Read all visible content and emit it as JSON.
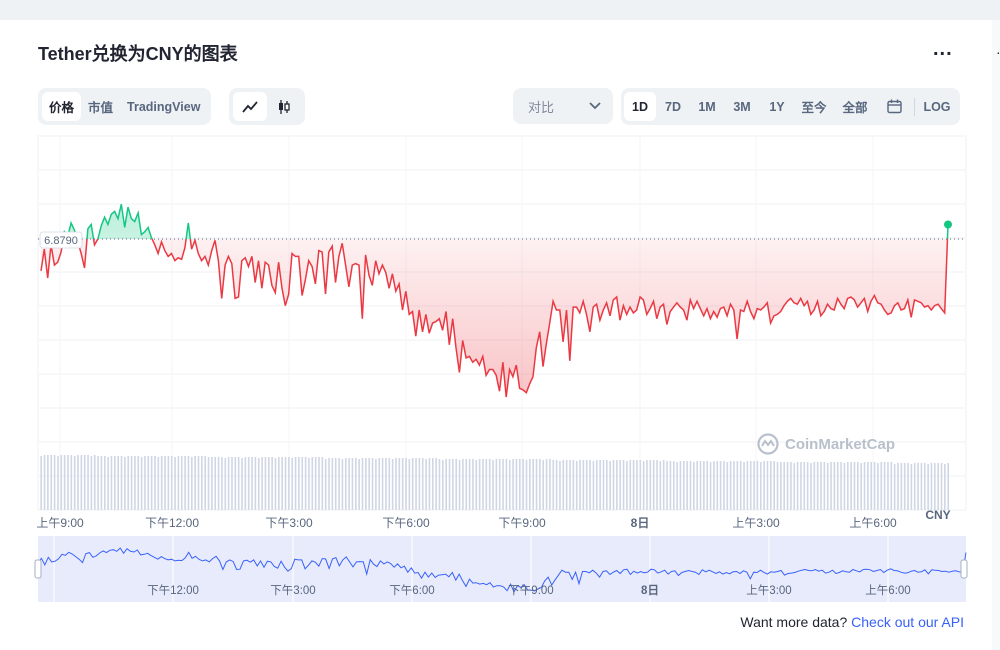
{
  "title": "Tether兑换为CNY的图表",
  "more_label": "...",
  "view_tabs": [
    "价格",
    "市值",
    "TradingView"
  ],
  "compare": {
    "label": "对比"
  },
  "range_tabs": [
    "1D",
    "7D",
    "1M",
    "3M",
    "1Y",
    "至今",
    "全部"
  ],
  "log_label": "LOG",
  "watermark": "CoinMarketCap",
  "api": {
    "prefix": "Want more data?",
    "link": "Check out our API"
  },
  "colors": {
    "up": "#16c784",
    "down": "#ea3943",
    "accent": "#3861fb",
    "volume": "#cfd6e4",
    "nav_fill": "#e5e9fc"
  },
  "chart_data": {
    "type": "line",
    "reference_value": 6.879,
    "reference_label": "6.8790",
    "currency_label": "CNY",
    "x_ticks": [
      "上午9:00",
      "下午12:00",
      "下午3:00",
      "下午6:00",
      "下午9:00",
      "8日",
      "上午3:00",
      "上午6:00"
    ],
    "nav_ticks": [
      "下午12:00",
      "下午3:00",
      "下午6:00",
      "下午9:00",
      "8日",
      "上午3:00",
      "上午6:00"
    ],
    "price_series": [
      6.8768,
      6.8783,
      6.8763,
      6.8786,
      6.8772,
      6.8774,
      6.8781,
      6.8795,
      6.8792,
      6.8801,
      6.8796,
      6.8788,
      6.878,
      6.877,
      6.8797,
      6.88,
      6.8786,
      6.879,
      6.8799,
      6.8805,
      6.88,
      6.8807,
      6.8809,
      6.8804,
      6.8814,
      6.8798,
      6.8812,
      6.8804,
      6.8802,
      6.8808,
      6.8793,
      6.8795,
      6.8798,
      6.8791,
      6.8786,
      6.878,
      6.8788,
      6.8782,
      6.8778,
      6.878,
      6.8775,
      6.8777,
      6.8776,
      6.8784,
      6.8801,
      6.8783,
      6.8789,
      6.878,
      6.8775,
      6.8778,
      6.8772,
      6.8782,
      6.8789,
      6.8775,
      6.8749,
      6.8772,
      6.8778,
      6.8773,
      6.8749,
      6.875,
      6.8775,
      6.8777,
      6.8771,
      6.8778,
      6.876,
      6.8775,
      6.8756,
      6.8774,
      6.8772,
      6.8758,
      6.8753,
      6.8774,
      6.8756,
      6.8744,
      6.8752,
      6.878,
      6.8778,
      6.8778,
      6.8751,
      6.8762,
      6.8775,
      6.8771,
      6.8759,
      6.8782,
      6.8781,
      6.8752,
      6.8781,
      6.8785,
      6.876,
      6.8778,
      6.8787,
      6.8772,
      6.8757,
      6.8772,
      6.8773,
      6.8772,
      6.8735,
      6.8779,
      6.8765,
      6.8758,
      6.8775,
      6.8766,
      6.8772,
      6.8767,
      6.8756,
      6.8766,
      6.8754,
      6.8759,
      6.8741,
      6.8754,
      6.8738,
      6.874,
      6.8723,
      6.8741,
      6.8726,
      6.8738,
      6.8725,
      6.8732,
      6.8733,
      6.8735,
      6.8727,
      6.874,
      6.8717,
      6.8735,
      6.8715,
      6.8698,
      6.872,
      6.8708,
      6.8709,
      6.8705,
      6.8707,
      6.8703,
      6.8709,
      6.8696,
      6.87,
      6.87,
      6.8696,
      6.8685,
      6.8705,
      6.8681,
      6.87,
      6.8695,
      6.8703,
      6.8687,
      6.8686,
      6.8684,
      6.869,
      6.8695,
      6.8715,
      6.8726,
      6.8702,
      6.8718,
      6.8732,
      6.8747,
      6.8741,
      6.8741,
      6.8719,
      6.8741,
      6.8706,
      6.8743,
      6.8743,
      6.8739,
      6.8747,
      6.8738,
      6.8726,
      6.8743,
      6.8745,
      6.8734,
      6.8741,
      6.8746,
      6.8737,
      6.8748,
      6.875,
      6.8734,
      6.8744,
      6.8738,
      6.8743,
      6.8739,
      6.8741,
      6.875,
      6.8748,
      6.8738,
      6.8742,
      6.8747,
      6.8735,
      6.8743,
      6.8745,
      6.8731,
      6.874,
      6.8743,
      6.8746,
      6.8743,
      6.8741,
      6.8734,
      6.8748,
      6.8742,
      6.8747,
      6.8742,
      6.8737,
      6.8742,
      6.8735,
      6.874,
      6.8736,
      6.8742,
      6.8743,
      6.8737,
      6.8745,
      6.8741,
      6.8721,
      6.8741,
      6.874,
      6.8747,
      6.874,
      6.8735,
      6.8742,
      6.8741,
      6.8743,
      6.8746,
      6.8732,
      6.8737,
      6.8738,
      6.874,
      6.8744,
      6.8747,
      6.8749,
      6.8746,
      6.8745,
      6.8749,
      6.8744,
      6.8747,
      6.8738,
      6.8741,
      6.8747,
      6.8737,
      6.874,
      6.8745,
      6.8742,
      6.8741,
      6.8749,
      6.8745,
      6.8742,
      6.8749,
      6.875,
      6.8748,
      6.8743,
      6.8746,
      6.8749,
      6.874,
      6.8747,
      6.8751,
      6.8746,
      6.8745,
      6.8741,
      6.8738,
      6.8739,
      6.8744,
      6.8746,
      6.8741,
      6.8742,
      6.8748,
      6.8736,
      6.8748,
      6.8747,
      6.8746,
      6.8743,
      6.8744,
      6.8741,
      6.8744,
      6.8745,
      6.8742,
      6.8739,
      6.88
    ]
  }
}
